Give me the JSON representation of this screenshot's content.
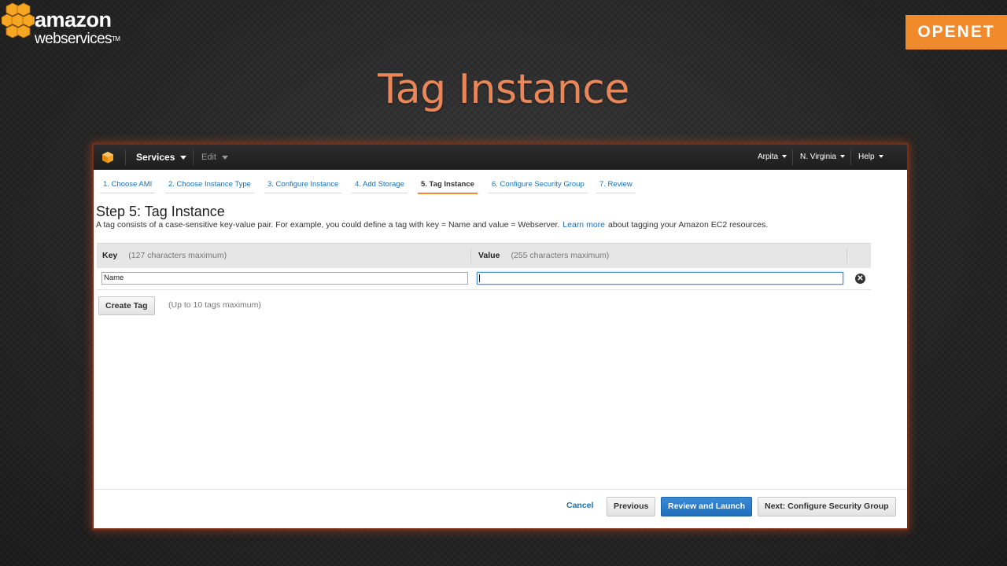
{
  "branding": {
    "aws_line1": "amazon",
    "aws_line2": "webservices",
    "aws_tm": "TM",
    "openet": "OPENET",
    "cube_color": "#f5a623",
    "openet_color": "#f08a2b"
  },
  "slide": {
    "title": "Tag Instance",
    "title_color": "#e9865a"
  },
  "topbar": {
    "logo_icon": "aws-cube-icon",
    "services_label": "Services",
    "edit_label": "Edit",
    "user_label": "Arpita",
    "region_label": "N. Virginia",
    "help_label": "Help"
  },
  "wizard": {
    "tabs": [
      {
        "label": "1. Choose AMI",
        "active": false
      },
      {
        "label": "2. Choose Instance Type",
        "active": false
      },
      {
        "label": "3. Configure Instance",
        "active": false
      },
      {
        "label": "4. Add Storage",
        "active": false
      },
      {
        "label": "5. Tag Instance",
        "active": true
      },
      {
        "label": "6. Configure Security Group",
        "active": false
      },
      {
        "label": "7. Review",
        "active": false
      }
    ],
    "accent_color": "#f08a2b"
  },
  "step": {
    "title": "Step 5: Tag Instance",
    "desc_before": "A tag consists of a case-sensitive key-value pair. For example, you could define a tag with key = Name and value = Webserver.",
    "learn_more": "Learn more",
    "desc_after": "about tagging your Amazon EC2 resources."
  },
  "tag_table": {
    "key_header": "Key",
    "key_hint": "(127 characters maximum)",
    "value_header": "Value",
    "value_hint": "(255 characters maximum)",
    "rows": [
      {
        "key": "Name",
        "value": ""
      }
    ],
    "remove_icon": "remove-circle-icon"
  },
  "actions": {
    "create_tag_label": "Create Tag",
    "create_tag_hint": "(Up to 10 tags maximum)",
    "cancel_label": "Cancel",
    "previous_label": "Previous",
    "review_launch_label": "Review and Launch",
    "next_label": "Next: Configure Security Group",
    "primary_color": "#1f6fbd"
  }
}
